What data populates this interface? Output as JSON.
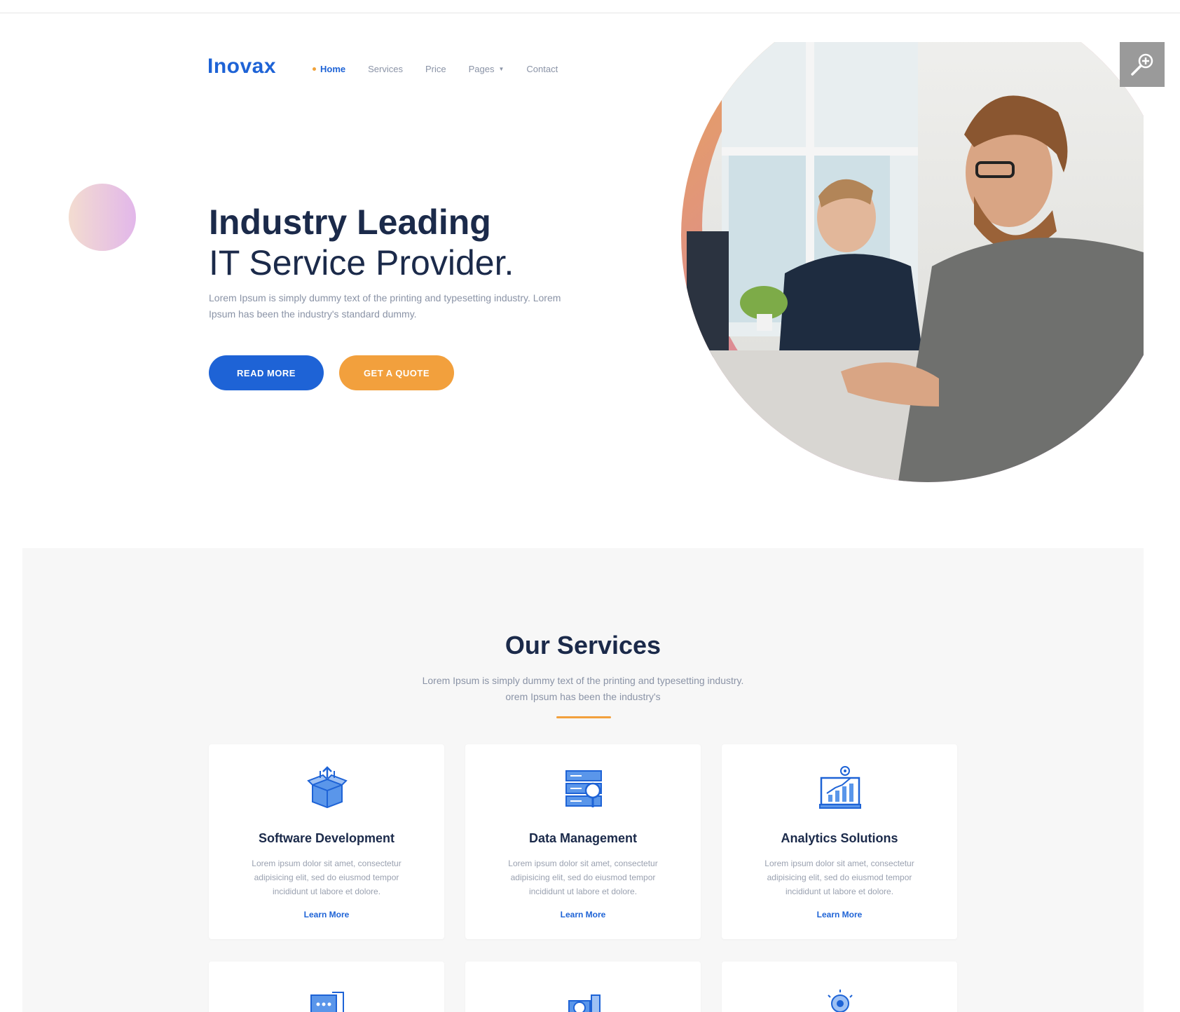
{
  "logo": {
    "text": "Inovax"
  },
  "nav": {
    "items": [
      {
        "label": "Home",
        "active": true
      },
      {
        "label": "Services"
      },
      {
        "label": "Price"
      },
      {
        "label": "Pages"
      },
      {
        "label": "Contact"
      }
    ]
  },
  "hero": {
    "title_line1": "Industry Leading",
    "title_line2": "IT Service Provider.",
    "text": "Lorem Ipsum is simply dummy text of the printing and typesetting industry. Lorem Ipsum has been the industry's standard dummy.",
    "read_more": "READ MORE",
    "get_quote": "GET A QUOTE"
  },
  "services": {
    "title": "Our Services",
    "subtitle": "Lorem Ipsum is simply dummy text of the printing and typesetting industry. orem Ipsum has been the industry's",
    "cards": [
      {
        "title": "Software Development",
        "text": "Lorem ipsum dolor sit amet, consectetur adipisicing elit, sed do eiusmod tempor incididunt ut labore et dolore.",
        "link": "Learn More",
        "icon": "box-upload-icon"
      },
      {
        "title": "Data Management",
        "text": "Lorem ipsum dolor sit amet, consectetur adipisicing elit, sed do eiusmod tempor incididunt ut labore et dolore.",
        "link": "Learn More",
        "icon": "server-search-icon"
      },
      {
        "title": "Analytics Solutions",
        "text": "Lorem ipsum dolor sit amet, consectetur adipisicing elit, sed do eiusmod tempor incididunt ut labore et dolore.",
        "link": "Learn More",
        "icon": "chart-laptop-icon"
      }
    ]
  },
  "colors": {
    "brand_blue": "#1e63d6",
    "accent_orange": "#f2a03d",
    "heading": "#1b2a4a"
  }
}
